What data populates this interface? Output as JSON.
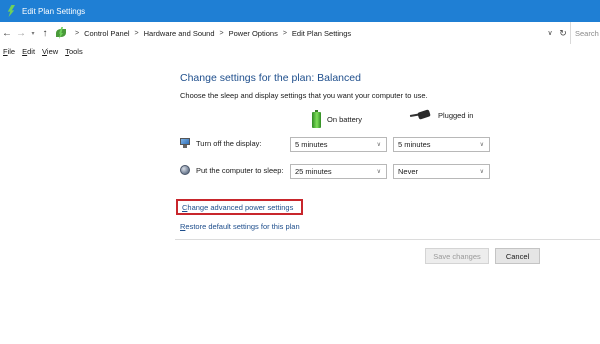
{
  "window": {
    "title": "Edit Plan Settings"
  },
  "address_bar": {
    "crumbs": [
      "Control Panel",
      "Hardware and Sound",
      "Power Options",
      "Edit Plan Settings"
    ],
    "search_placeholder": "Search"
  },
  "menu": {
    "items": [
      {
        "accel": "F",
        "rest": "ile"
      },
      {
        "accel": "E",
        "rest": "dit"
      },
      {
        "accel": "V",
        "rest": "iew"
      },
      {
        "accel": "T",
        "rest": "ools"
      }
    ]
  },
  "content": {
    "heading": "Change settings for the plan: Balanced",
    "subheading": "Choose the sleep and display settings that you want your computer to use.",
    "columns": {
      "on_battery": "On battery",
      "plugged_in": "Plugged in"
    },
    "rows": [
      {
        "label": "Turn off the display:",
        "on_battery": "5 minutes",
        "plugged_in": "5 minutes"
      },
      {
        "label": "Put the computer to sleep:",
        "on_battery": "25 minutes",
        "plugged_in": "Never"
      }
    ],
    "links": {
      "advanced_accel": "C",
      "advanced_rest": "hange advanced power settings",
      "restore_accel": "R",
      "restore_rest": "estore default settings for this plan"
    },
    "buttons": {
      "save": "Save changes",
      "cancel": "Cancel"
    }
  },
  "colors": {
    "titlebar": "#1f7fd4",
    "link": "#1e4e8c",
    "highlight_box": "#c8262c"
  }
}
